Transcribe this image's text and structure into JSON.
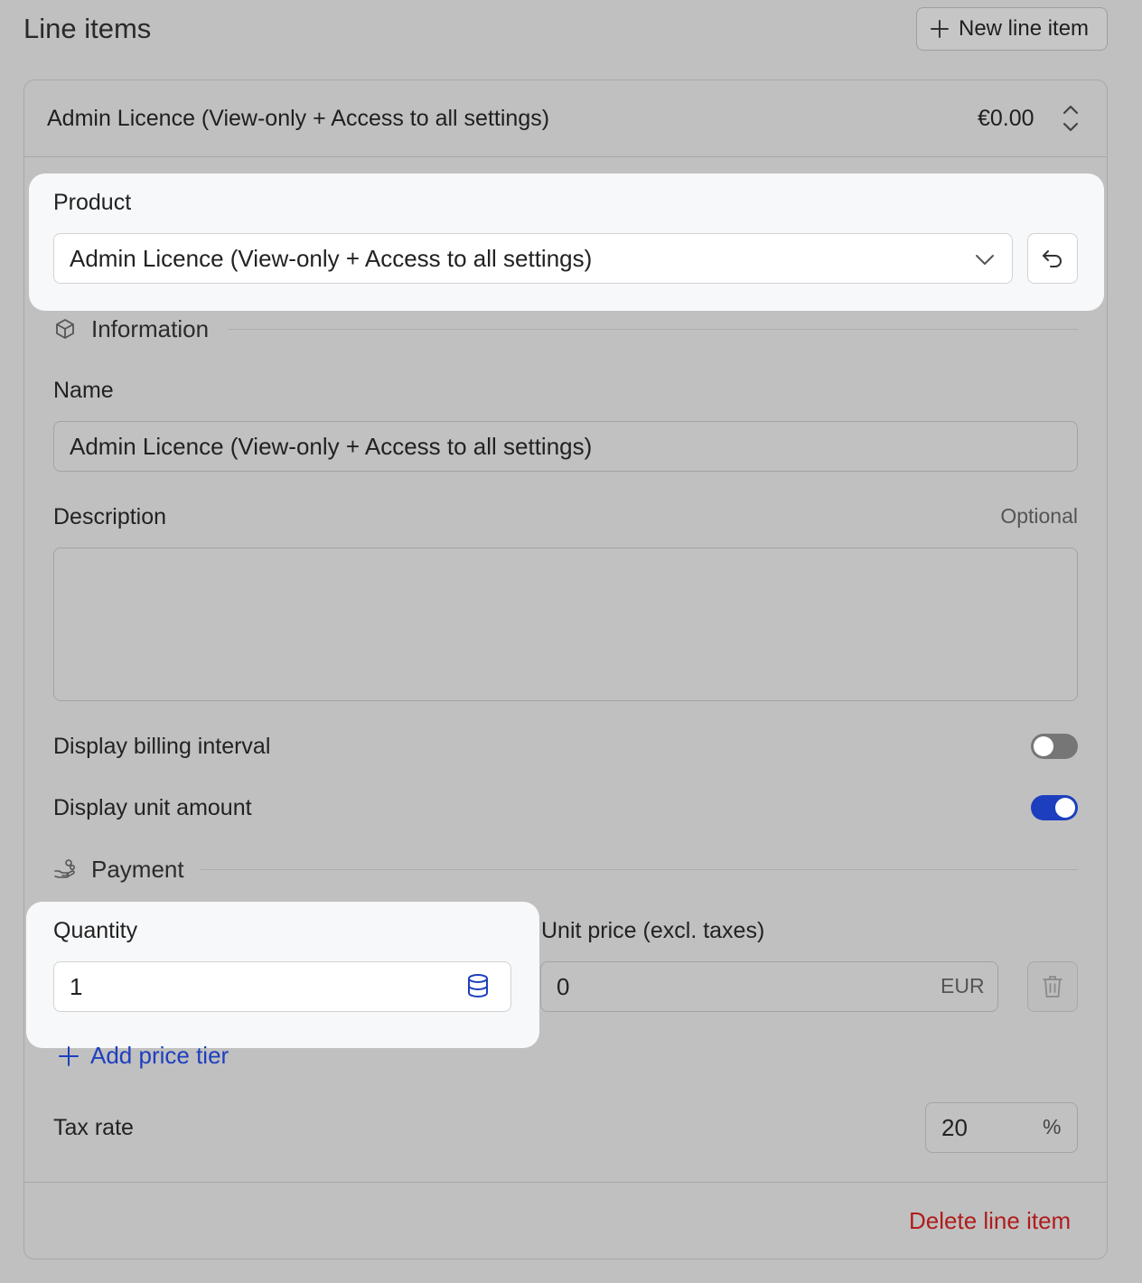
{
  "section": {
    "title": "Line items",
    "new_button_label": "New line item"
  },
  "line_item": {
    "header_title": "Admin Licence (View-only + Access to all settings)",
    "header_amount": "€0.00",
    "product": {
      "label": "Product",
      "selected": "Admin Licence (View-only + Access to all settings)"
    },
    "information": {
      "heading": "Information",
      "name_label": "Name",
      "name_value": "Admin Licence (View-only + Access to all settings)",
      "description_label": "Description",
      "description_optional": "Optional",
      "description_value": ""
    },
    "toggles": {
      "billing_interval_label": "Display billing interval",
      "billing_interval_on": false,
      "unit_amount_label": "Display unit amount",
      "unit_amount_on": true
    },
    "payment": {
      "heading": "Payment",
      "quantity_label": "Quantity",
      "quantity_value": "1",
      "unit_price_label": "Unit price (excl. taxes)",
      "unit_price_value": "0",
      "currency": "EUR",
      "add_tier_label": "Add price tier",
      "tax_rate_label": "Tax rate",
      "tax_rate_value": "20",
      "tax_rate_unit": "%"
    },
    "delete_label": "Delete line item"
  },
  "colors": {
    "accent": "#1d3fbf",
    "danger": "#b01c1c"
  }
}
